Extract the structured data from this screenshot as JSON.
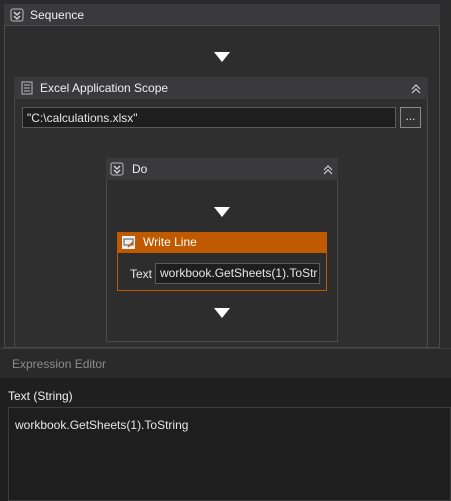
{
  "sequence": {
    "title": "Sequence"
  },
  "excel_scope": {
    "title": "Excel Application Scope",
    "path_value": "\"C:\\calculations.xlsx\"",
    "browse_label": "..."
  },
  "do_block": {
    "title": "Do"
  },
  "write_line": {
    "title": "Write Line",
    "text_label": "Text",
    "text_value": "workbook.GetSheets(1).ToStr"
  },
  "expression_editor": {
    "title": "Expression Editor",
    "field_label": "Text (String)",
    "expression": "workbook.GetSheets(1).ToString"
  },
  "colors": {
    "accent": "#c05a00",
    "background": "#252526"
  }
}
